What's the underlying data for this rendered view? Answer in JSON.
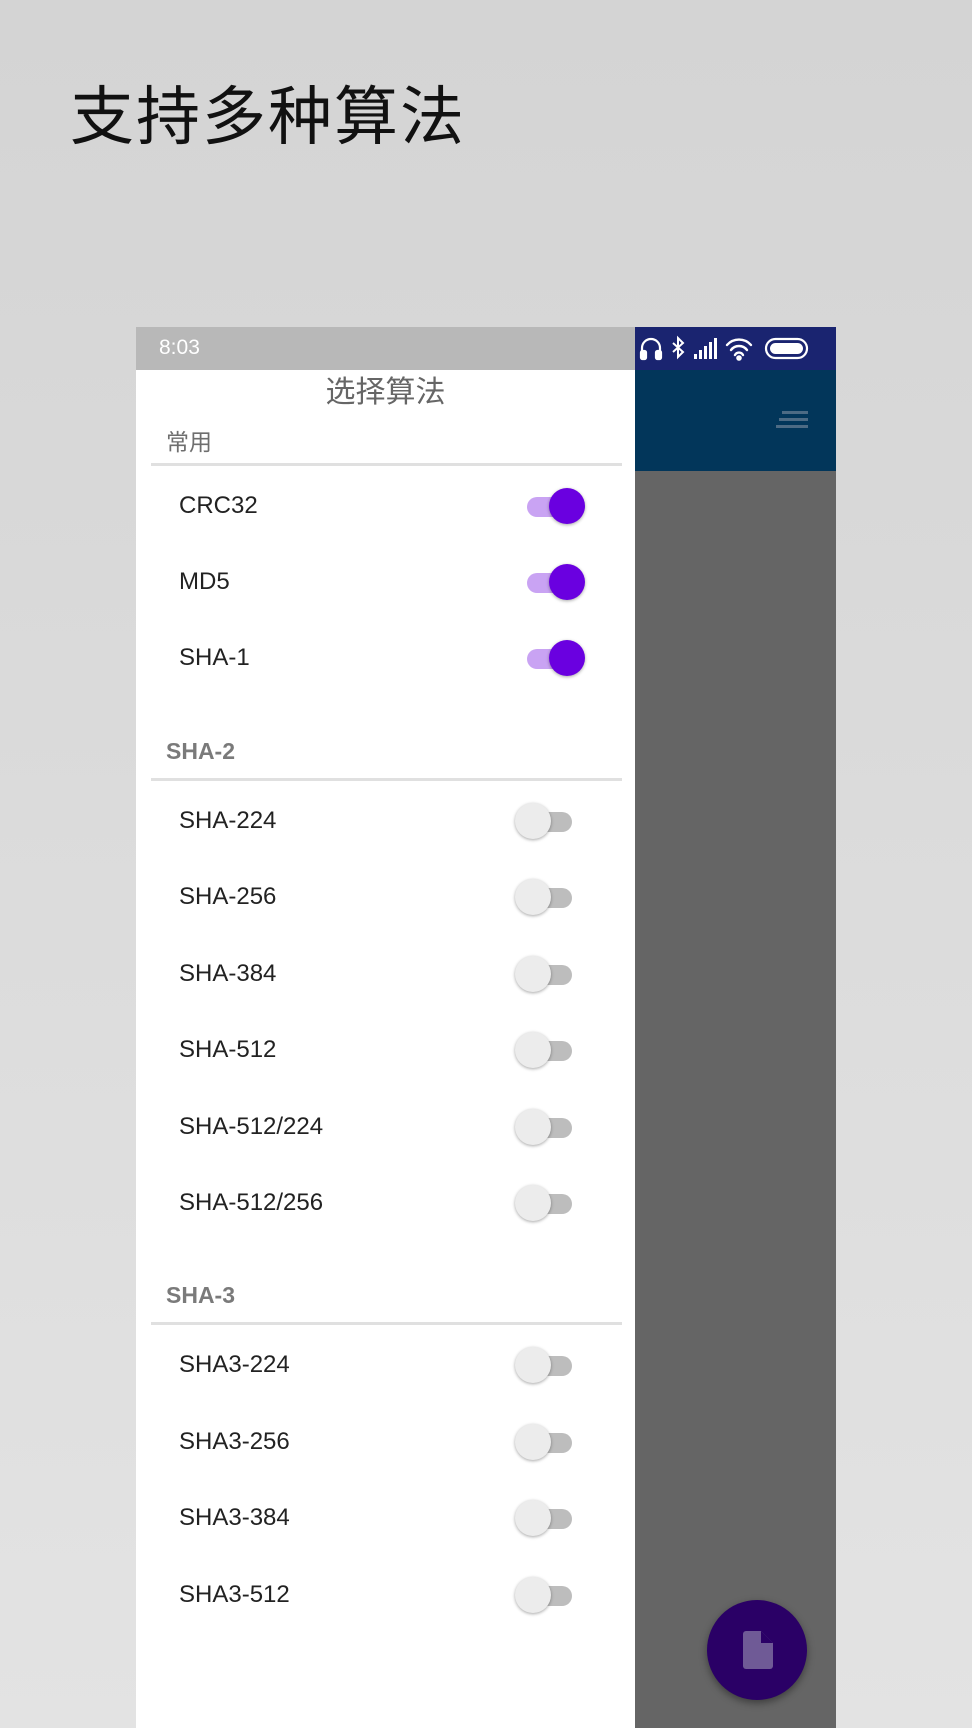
{
  "headline": "支持多种算法",
  "status_bar": {
    "time": "8:03"
  },
  "drawer": {
    "title": "选择算法",
    "sections": [
      {
        "label": "常用",
        "items": [
          {
            "label": "CRC32",
            "checked": true
          },
          {
            "label": "MD5",
            "checked": true
          },
          {
            "label": "SHA-1",
            "checked": true
          }
        ]
      },
      {
        "label": "SHA-2",
        "items": [
          {
            "label": "SHA-224",
            "checked": false
          },
          {
            "label": "SHA-256",
            "checked": false
          },
          {
            "label": "SHA-384",
            "checked": false
          },
          {
            "label": "SHA-512",
            "checked": false
          },
          {
            "label": "SHA-512/224",
            "checked": false
          },
          {
            "label": "SHA-512/256",
            "checked": false
          }
        ]
      },
      {
        "label": "SHA-3",
        "items": [
          {
            "label": "SHA3-224",
            "checked": false
          },
          {
            "label": "SHA3-256",
            "checked": false
          },
          {
            "label": "SHA3-384",
            "checked": false
          },
          {
            "label": "SHA3-512",
            "checked": false
          }
        ]
      }
    ]
  },
  "colors": {
    "switch_on_thumb": "#6a00e0",
    "switch_on_track": "#c9a3f3",
    "app_bar": "#02365a",
    "status_bar_right": "#1a2470",
    "fab": "#2a0066"
  },
  "icons": {
    "status": [
      "headphones-icon",
      "bluetooth-icon",
      "signal-icon",
      "wifi-icon",
      "battery-icon"
    ],
    "menu": "menu-icon",
    "fab": "file-icon"
  }
}
